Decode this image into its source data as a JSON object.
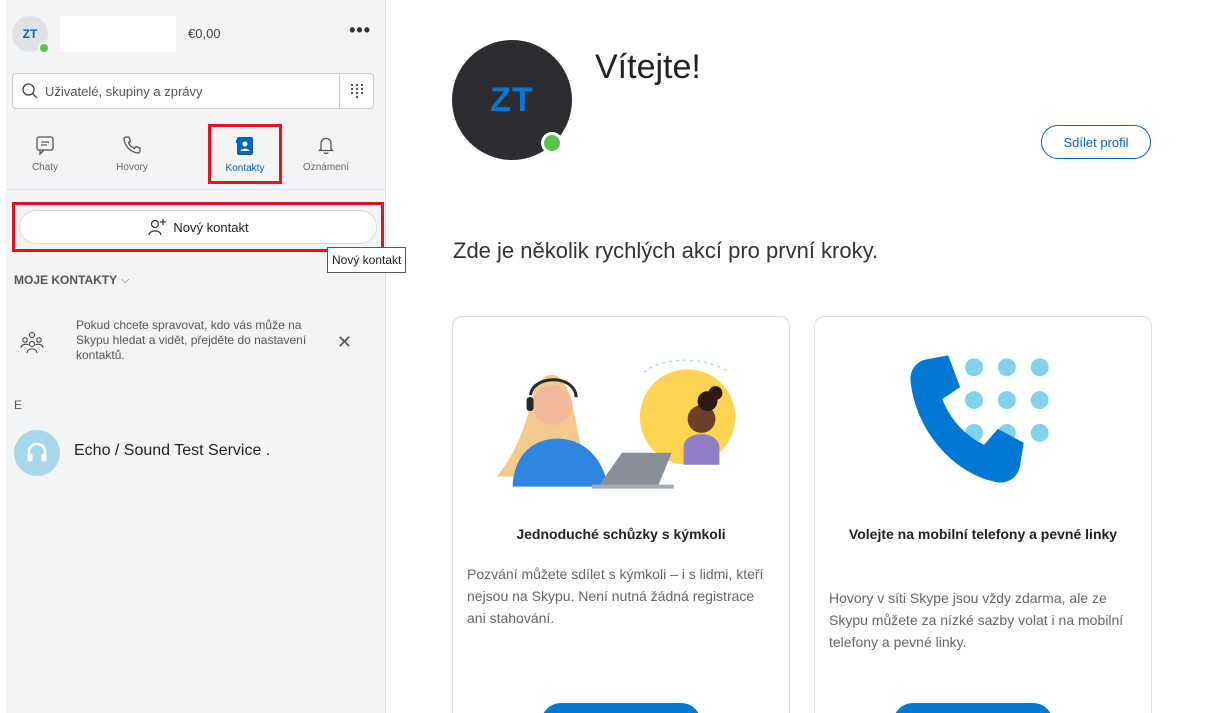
{
  "profile": {
    "initials": "ZT",
    "credit": "€0,00"
  },
  "search": {
    "placeholder": "Uživatelé, skupiny a zprávy"
  },
  "tabs": [
    {
      "label": "Chaty"
    },
    {
      "label": "Hovory"
    },
    {
      "label": "Kontakty"
    },
    {
      "label": "Oznámení"
    }
  ],
  "new_contact": {
    "label": "Nový kontakt",
    "tooltip": "Nový kontakt"
  },
  "contacts_section": {
    "title": "MOJE KONTAKTY"
  },
  "notice": {
    "text": "Pokud chcete spravovat, kdo vás může na Skypu hledat a vidět, přejděte do nastavení kontaktů."
  },
  "groups": [
    {
      "letter": "E",
      "items": [
        {
          "name": "Echo / Sound Test Service ."
        }
      ]
    }
  ],
  "main": {
    "initials": "ZT",
    "welcome": "Vítejte!",
    "share_label": "Sdílet profil",
    "quick_title": "Zde je několik rychlých akcí pro první kroky.",
    "cards": [
      {
        "title": "Jednoduché schůzky s kýmkoli",
        "text": "Pozvání můžete sdílet s kýmkoli – i s lidmi, kteří nejsou na Skypu. Není nutná žádná registrace ani stahování."
      },
      {
        "title": "Volejte na mobilní telefony a pevné linky",
        "text": "Hovory v síti Skype jsou vždy zdarma, ale ze Skypu můžete za nízké sazby volat i na mobilní telefony a pevné linky."
      }
    ]
  },
  "colors": {
    "accent": "#0078d4",
    "highlight": "#e3141e",
    "presence": "#55c746"
  }
}
